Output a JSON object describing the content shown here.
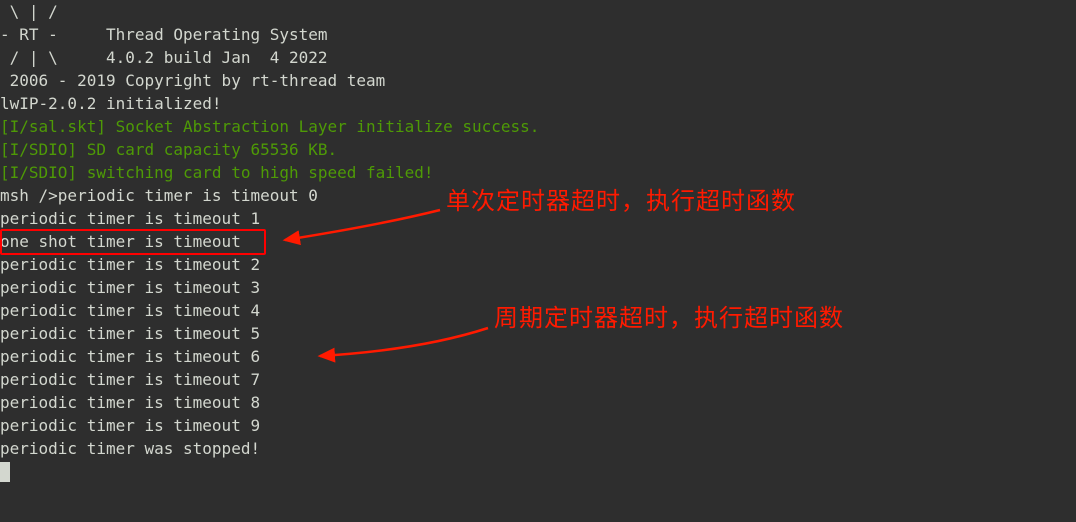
{
  "terminal": {
    "banner_l1": " \\ | /",
    "banner_l2": "- RT -     Thread Operating System",
    "banner_l3": " / | \\     4.0.2 build Jan  4 2022",
    "banner_l4": " 2006 - 2019 Copyright by rt-thread team",
    "lwip": "lwIP-2.0.2 initialized!",
    "sal": "[I/sal.skt] Socket Abstraction Layer initialize success.",
    "sdio1": "[I/SDIO] SD card capacity 65536 KB.",
    "sdio2": "[I/SDIO] switching card to high speed failed!",
    "msh_prompt": "msh />",
    "periodic0": "periodic timer is timeout 0",
    "periodic1": "periodic timer is timeout 1",
    "oneshot": "one shot timer is timeout",
    "periodic2": "periodic timer is timeout 2",
    "periodic3": "periodic timer is timeout 3",
    "periodic4": "periodic timer is timeout 4",
    "periodic5": "periodic timer is timeout 5",
    "periodic6": "periodic timer is timeout 6",
    "periodic7": "periodic timer is timeout 7",
    "periodic8": "periodic timer is timeout 8",
    "periodic9": "periodic timer is timeout 9",
    "stopped": "periodic timer was stopped!"
  },
  "annotations": {
    "oneshot_text": "单次定时器超时，执行超时函数",
    "periodic_text": "周期定时器超时，执行超时函数"
  }
}
